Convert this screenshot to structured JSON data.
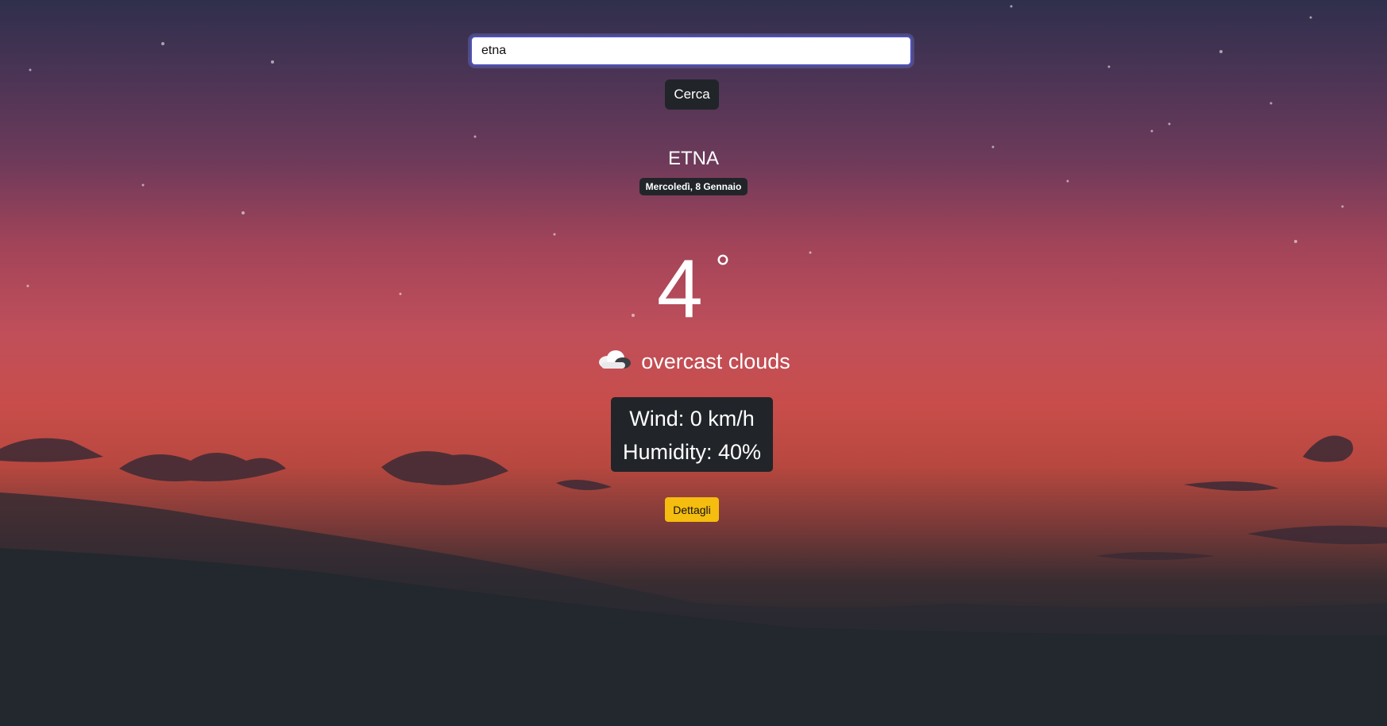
{
  "search": {
    "value": "etna",
    "button_label": "Cerca"
  },
  "weather": {
    "city": "ETNA",
    "date": "Mercoledì, 8 Gennaio",
    "temperature": "4",
    "degree_symbol": "°",
    "condition_icon": "cloud-icon",
    "condition": "overcast clouds",
    "wind": "Wind: 0 km/h",
    "humidity": "Humidity: 40%"
  },
  "details": {
    "button_label": "Dettagli"
  },
  "colors": {
    "button_dark": "#212529",
    "details_button": "#f5bd0f",
    "focus_border": "#4e52b8"
  }
}
